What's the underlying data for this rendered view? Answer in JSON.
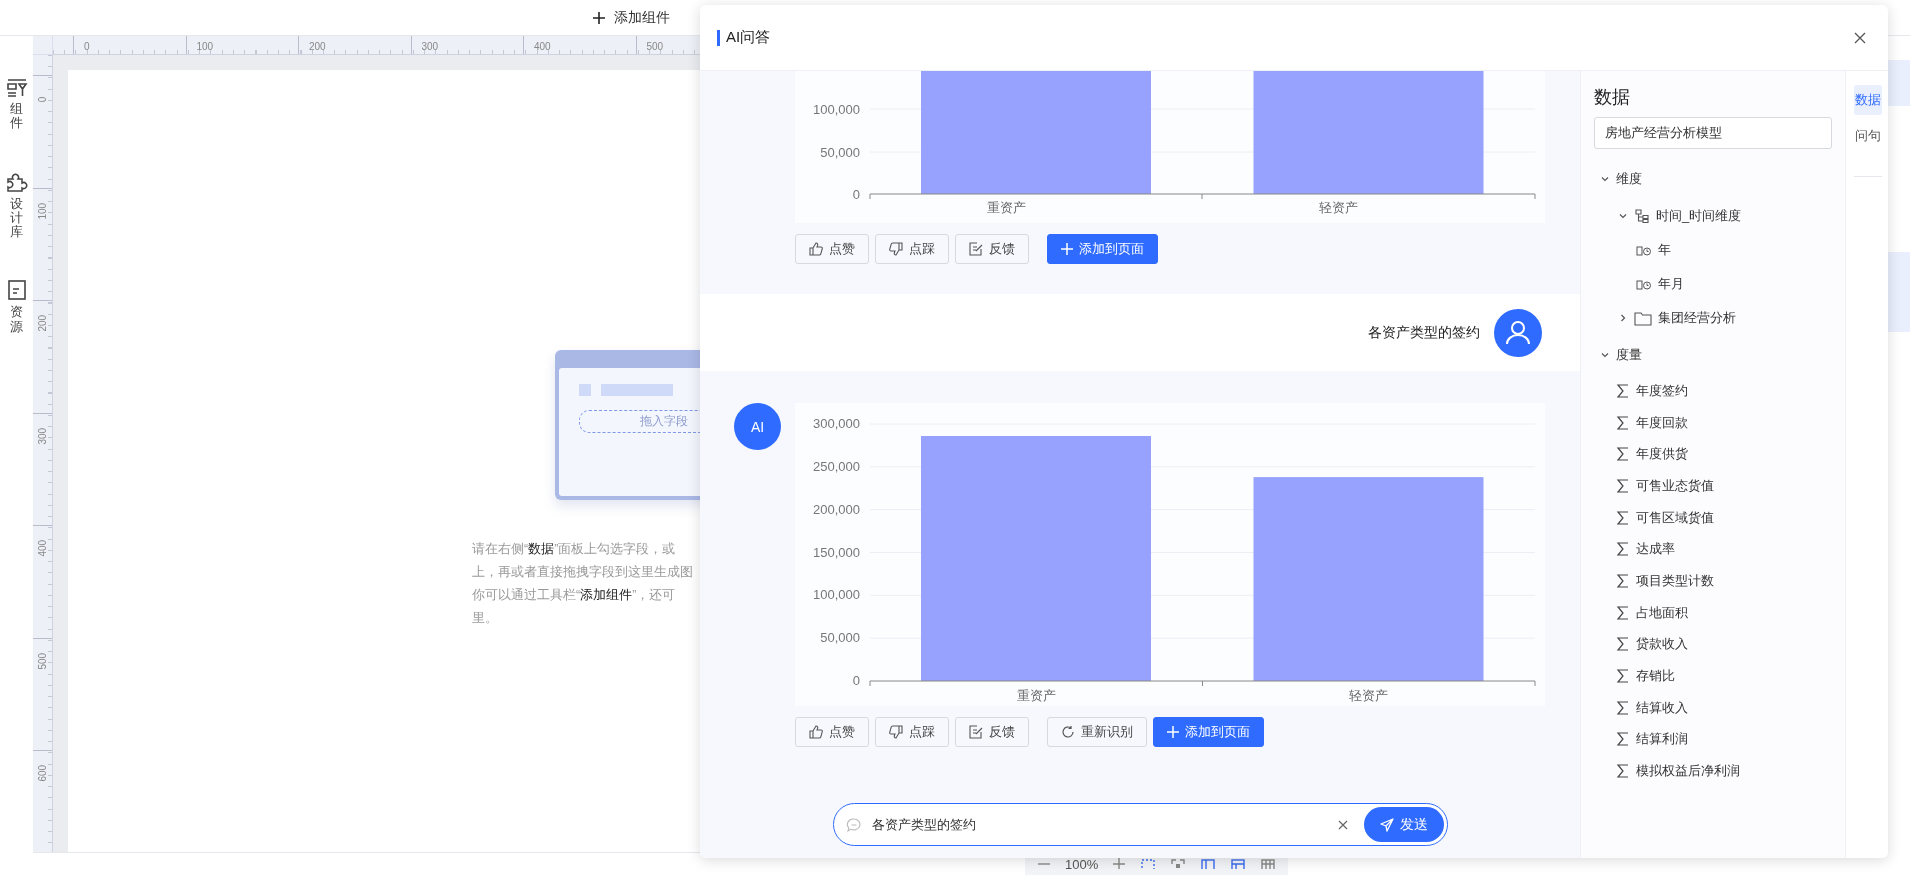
{
  "toolbar": {
    "add_component": "添加组件"
  },
  "sidebar": [
    {
      "label": "组件",
      "kind": "components"
    },
    {
      "label": "设计库",
      "kind": "library"
    },
    {
      "label": "资源",
      "kind": "resources"
    }
  ],
  "rulers": {
    "horizontal": [
      "0",
      "100",
      "200",
      "300",
      "400",
      "500"
    ],
    "vertical": [
      "0",
      "100",
      "200",
      "300",
      "400",
      "500",
      "600"
    ]
  },
  "canvas": {
    "drop_hint": "拖入字段",
    "hint_lines": [
      "请在右侧“**数据**”面板上勾选字段，或",
      "上，再或者直接拖拽字段到这里生成图",
      "你可以通过工具栏“**添加组件**”，还可",
      "里。"
    ]
  },
  "zoom_bar": {
    "zoom": "100%"
  },
  "dialog": {
    "title": "AI问答",
    "messages": [
      {
        "kind": "assistant",
        "chart_preview": {
          "ytick_labels": [
            "100,000",
            "50,000",
            "0"
          ],
          "categories": [
            "重资产",
            "轻资产"
          ]
        },
        "actions": [
          {
            "kind": "like",
            "label": "点赞"
          },
          {
            "kind": "dislike",
            "label": "点踩"
          },
          {
            "kind": "feedback",
            "label": "反馈"
          },
          {
            "kind": "add",
            "label": "添加到页面"
          }
        ]
      },
      {
        "kind": "user",
        "text": "各资产类型的签约"
      },
      {
        "kind": "assistant",
        "avatar": "AI",
        "chart_data": {
          "type": "bar",
          "grid": true,
          "categories": [
            "重资产",
            "轻资产"
          ],
          "series": [
            {
              "color": "#96a2fd",
              "values": [
                286000,
                238000
              ]
            }
          ],
          "ylim": [
            0,
            300000
          ],
          "yticks": [
            {
              "value": 0,
              "label": "0"
            },
            {
              "value": 50000,
              "label": "50,000"
            },
            {
              "value": 100000,
              "label": "100,000"
            },
            {
              "value": 150000,
              "label": "150,000"
            },
            {
              "value": 200000,
              "label": "200,000"
            },
            {
              "value": 250000,
              "label": "250,000"
            },
            {
              "value": 300000,
              "label": "300,000"
            }
          ]
        },
        "actions": [
          {
            "kind": "like",
            "label": "点赞"
          },
          {
            "kind": "dislike",
            "label": "点踩"
          },
          {
            "kind": "feedback",
            "label": "反馈"
          },
          {
            "kind": "retry",
            "label": "重新识别"
          },
          {
            "kind": "add",
            "label": "添加到页面"
          }
        ]
      }
    ],
    "input": {
      "value": "各资产类型的签约",
      "send": "发送"
    },
    "data_panel": {
      "title": "数据",
      "model": "房地产经营分析模型",
      "tree": [
        {
          "label": "维度",
          "kind": "group",
          "expanded": true,
          "children": [
            {
              "label": "时间_时间维度",
              "kind": "hierarchy",
              "expanded": true,
              "children": [
                {
                  "label": "年",
                  "kind": "field"
                },
                {
                  "label": "年月",
                  "kind": "field"
                }
              ]
            },
            {
              "label": "集团经营分析",
              "kind": "folder",
              "expanded": false
            }
          ]
        },
        {
          "label": "度量",
          "kind": "group",
          "expanded": true,
          "children": [
            {
              "label": "年度签约",
              "kind": "measure"
            },
            {
              "label": "年度回款",
              "kind": "measure"
            },
            {
              "label": "年度供货",
              "kind": "measure"
            },
            {
              "label": "可售业态货值",
              "kind": "measure"
            },
            {
              "label": "可售区域货值",
              "kind": "measure"
            },
            {
              "label": "达成率",
              "kind": "measure"
            },
            {
              "label": "项目类型计数",
              "kind": "measure"
            },
            {
              "label": "占地面积",
              "kind": "measure"
            },
            {
              "label": "贷款收入",
              "kind": "measure"
            },
            {
              "label": "存销比",
              "kind": "measure"
            },
            {
              "label": "结算收入",
              "kind": "measure"
            },
            {
              "label": "结算利润",
              "kind": "measure"
            },
            {
              "label": "模拟权益后净利润",
              "kind": "measure"
            }
          ]
        }
      ]
    },
    "tabs": [
      {
        "label": "数据",
        "selected": true
      },
      {
        "label": "问句",
        "selected": false
      }
    ]
  }
}
